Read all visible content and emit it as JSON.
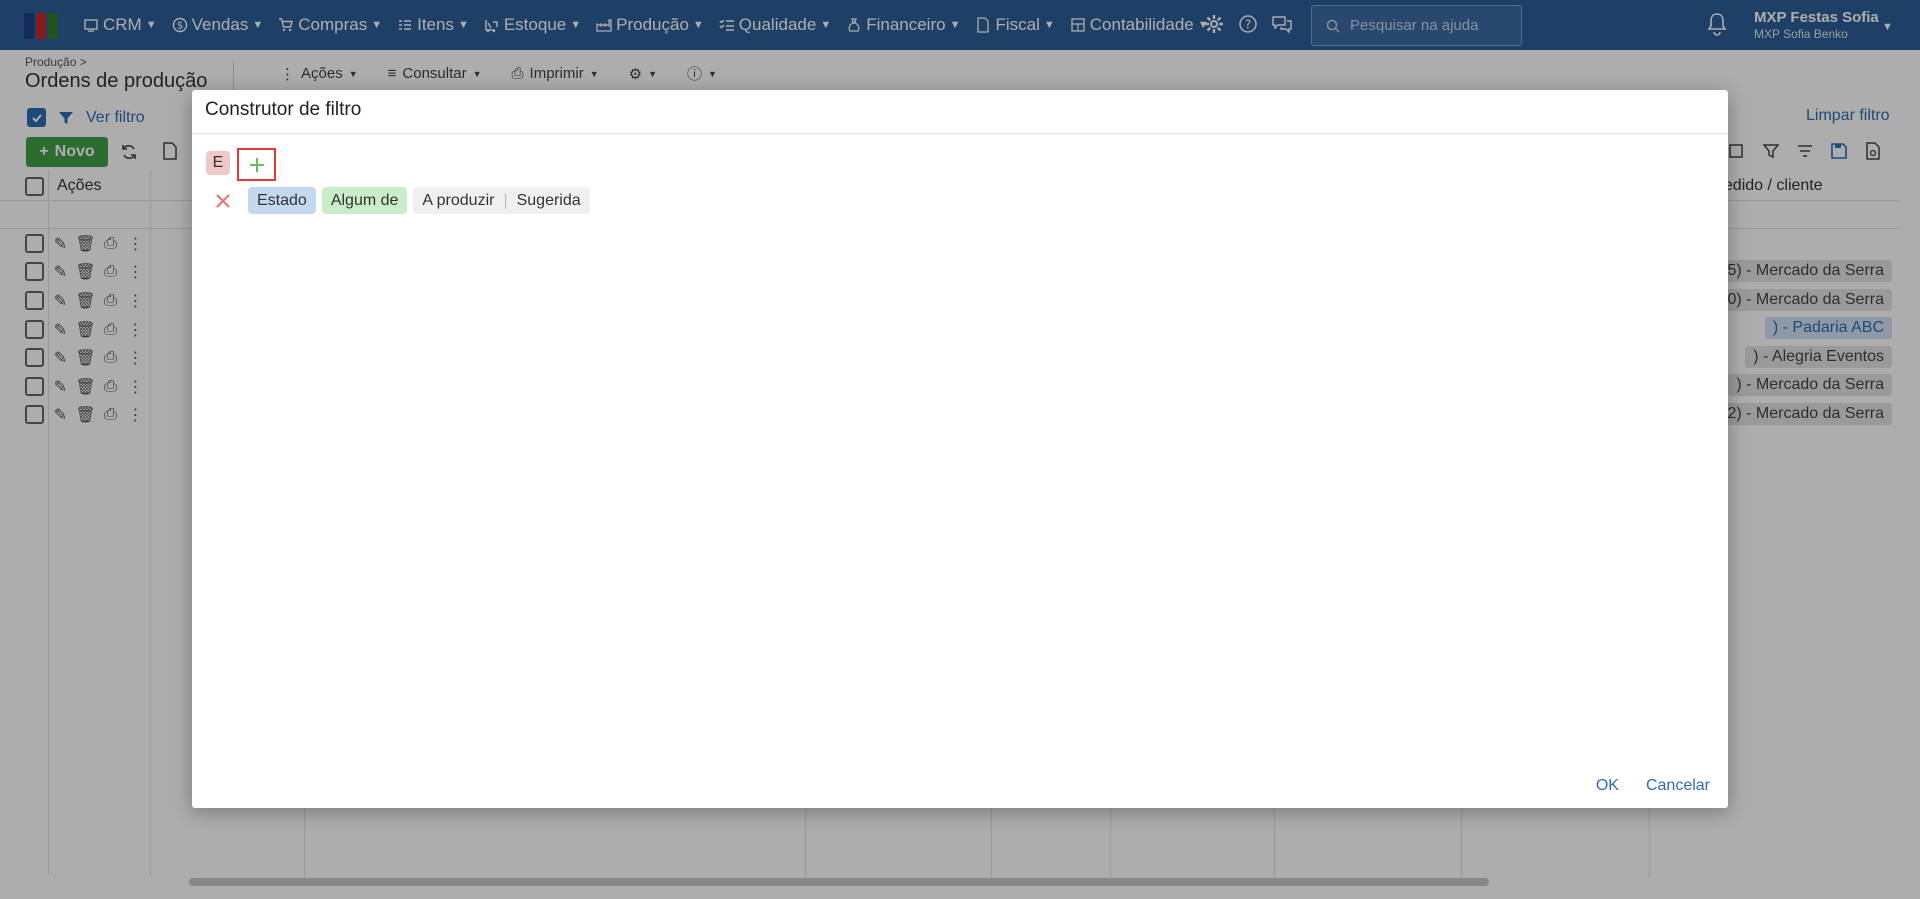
{
  "nav": {
    "items": [
      {
        "label": "CRM",
        "icon": "crm-icon"
      },
      {
        "label": "Vendas",
        "icon": "dollar-icon"
      },
      {
        "label": "Compras",
        "icon": "cart-icon"
      },
      {
        "label": "Itens",
        "icon": "items-icon"
      },
      {
        "label": "Estoque",
        "icon": "forklift-icon"
      },
      {
        "label": "Produção",
        "icon": "factory-icon"
      },
      {
        "label": "Qualidade",
        "icon": "checklist-icon"
      },
      {
        "label": "Financeiro",
        "icon": "money-bag-icon"
      },
      {
        "label": "Fiscal",
        "icon": "document-icon"
      },
      {
        "label": "Contabilidade",
        "icon": "calculator-icon"
      }
    ],
    "search_placeholder": "Pesquisar na ajuda",
    "user_name": "MXP Festas Sofia",
    "user_sub": "MXP Sofia Benko",
    "brand_color": "#2d5f98"
  },
  "page": {
    "breadcrumb": "Produção >",
    "title": "Ordens de produção",
    "toolbar": [
      "Ações",
      "Consultar",
      "Imprimir"
    ],
    "ver_filtro": "Ver filtro",
    "limpar_filtro": "Limpar filtro",
    "novo_label": "Novo",
    "col_acoes": "Ações",
    "col_pedido": "pedido / cliente",
    "rows": [
      {
        "customer": "5) - Mercado da Serra",
        "highlight": false
      },
      {
        "customer": "0) - Mercado da Serra",
        "highlight": false
      },
      {
        "customer": ") - Padaria ABC",
        "highlight": true
      },
      {
        "customer": ") - Alegria Eventos",
        "highlight": false
      },
      {
        "customer": ") - Mercado da Serra",
        "highlight": false
      },
      {
        "customer": "2) - Mercado da Serra",
        "highlight": false
      }
    ]
  },
  "modal": {
    "title": "Construtor de filtro",
    "group_operator": "E",
    "condition": {
      "field": "Estado",
      "operator": "Algum de",
      "values": [
        "A produzir",
        "Sugerida"
      ]
    },
    "ok_label": "OK",
    "cancel_label": "Cancelar"
  }
}
